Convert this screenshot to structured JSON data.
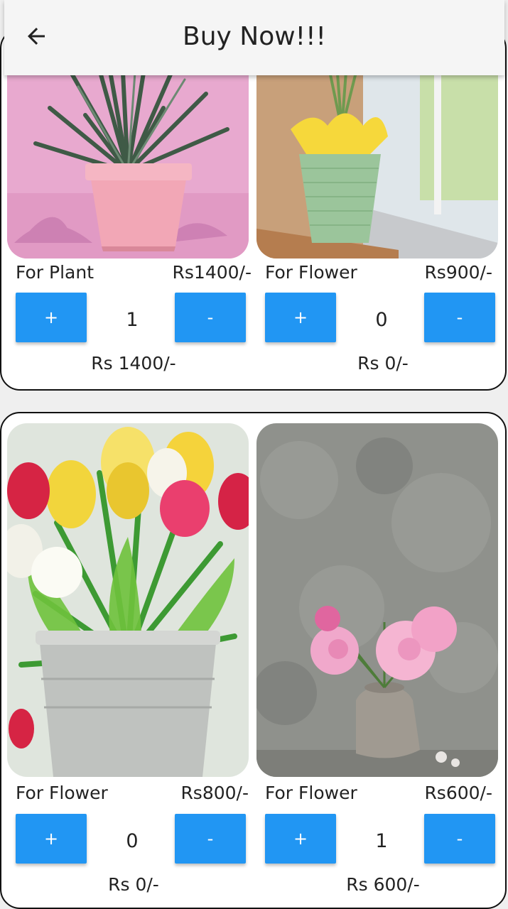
{
  "app_bar": {
    "title": "Buy Now!!!",
    "back_icon": "arrow-left-icon"
  },
  "colors": {
    "accent": "#2196f3",
    "card_background": "#ffffff",
    "page_background": "#efefef"
  },
  "products": [
    {
      "label": "For Plant",
      "price": "Rs1400/-",
      "plus_label": "+",
      "minus_label": "-",
      "quantity": "1",
      "total": "Rs 1400/-",
      "image": "aloe-plant-pink-pot"
    },
    {
      "label": "For Flower",
      "price": "Rs900/-",
      "plus_label": "+",
      "minus_label": "-",
      "quantity": "0",
      "total": "Rs 0/-",
      "image": "green-vase-window"
    },
    {
      "label": "For Flower",
      "price": "Rs800/-",
      "plus_label": "+",
      "minus_label": "-",
      "quantity": "0",
      "total": "Rs 0/-",
      "image": "tulips-metal-bucket"
    },
    {
      "label": "For Flower",
      "price": "Rs600/-",
      "plus_label": "+",
      "minus_label": "-",
      "quantity": "1",
      "total": "Rs 600/-",
      "image": "pink-peonies-vase"
    }
  ]
}
